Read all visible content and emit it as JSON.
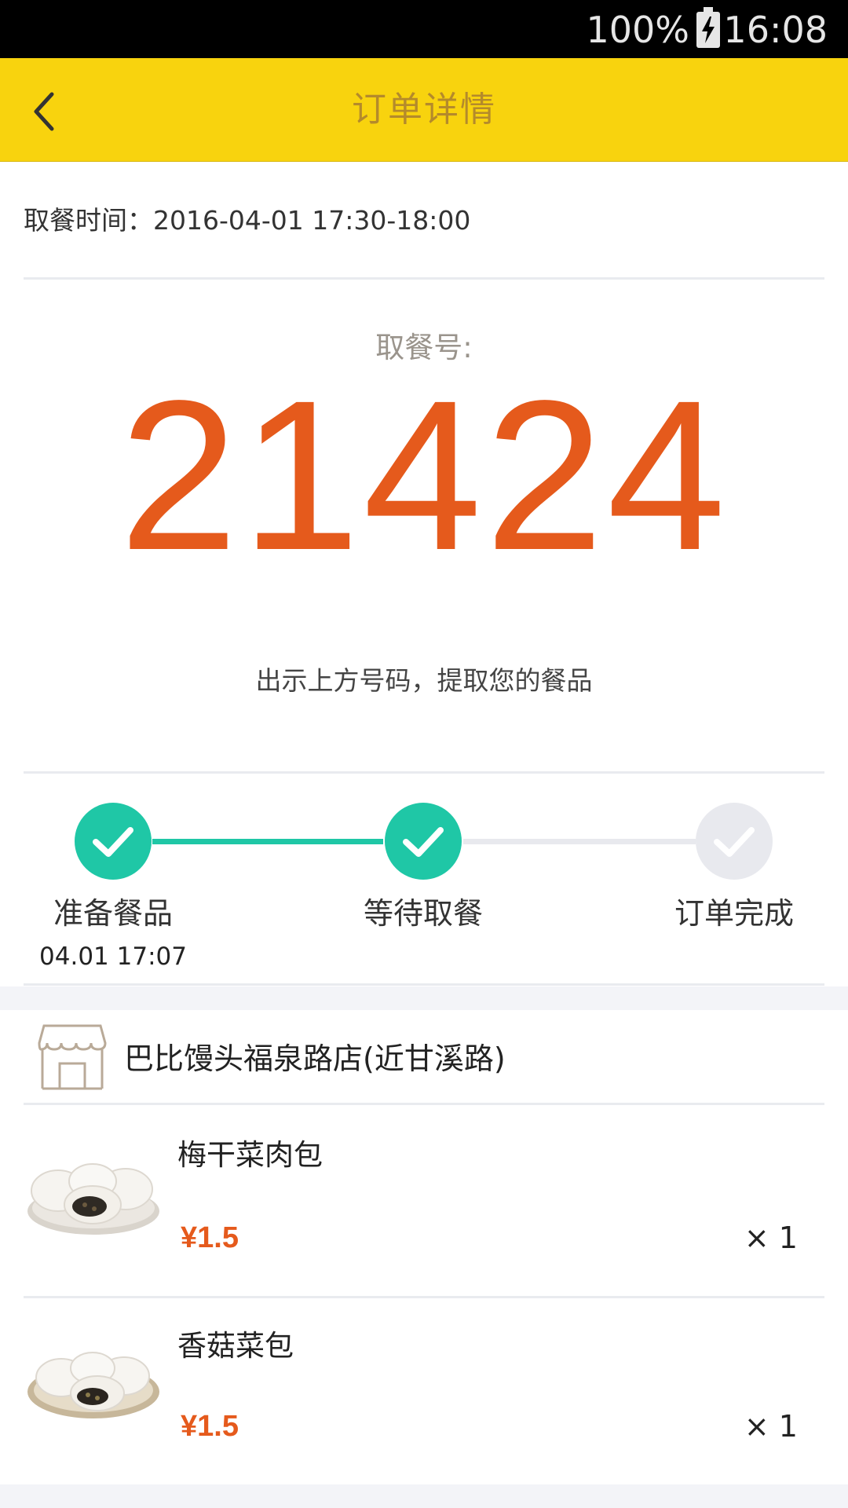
{
  "status_bar": {
    "battery": "100%",
    "time": "16:08"
  },
  "header": {
    "title": "订单详情"
  },
  "pickup": {
    "time_label": "取餐时间：",
    "time_value": "2016-04-01 17:30-18:00",
    "code_label": "取餐号:",
    "code": "21424",
    "hint": "出示上方号码，提取您的餐品"
  },
  "progress": {
    "steps": [
      {
        "label": "准备餐品",
        "time": "04.01 17:07",
        "done": true
      },
      {
        "label": "等待取餐",
        "time": "",
        "done": true
      },
      {
        "label": "订单完成",
        "time": "",
        "done": false
      }
    ],
    "colors": {
      "done": "#1fc7a6",
      "pending": "#e8e9ee"
    }
  },
  "store": {
    "name": "巴比馒头福泉路店(近甘溪路)",
    "icon": "store-icon"
  },
  "items": [
    {
      "name": "梅干菜肉包",
      "price": "¥1.5",
      "qty": "× 1"
    },
    {
      "name": "香菇菜包",
      "price": "¥1.5",
      "qty": "× 1"
    }
  ],
  "colors": {
    "accent": "#f8d30e",
    "highlight": "#e55a1c"
  }
}
